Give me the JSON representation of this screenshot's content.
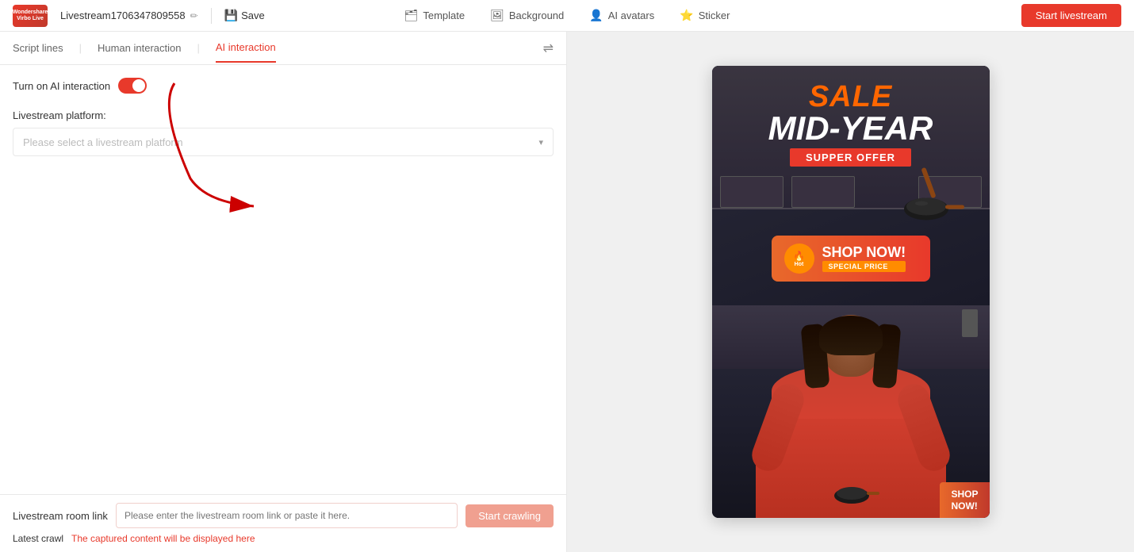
{
  "header": {
    "logo_line1": "Wondershare",
    "logo_line2": "Virbo Live",
    "project_title": "Livestream1706347809558",
    "save_label": "Save",
    "nav_items": [
      {
        "id": "template",
        "label": "Template",
        "icon": "🗂"
      },
      {
        "id": "background",
        "label": "Background",
        "icon": "🖼"
      },
      {
        "id": "ai_avatars",
        "label": "AI avatars",
        "icon": "👤"
      },
      {
        "id": "sticker",
        "label": "Sticker",
        "icon": "⭐"
      }
    ],
    "start_button_label": "Start livestream"
  },
  "left_panel": {
    "tabs": [
      {
        "id": "script_lines",
        "label": "Script lines",
        "active": false
      },
      {
        "id": "human_interaction",
        "label": "Human interaction",
        "active": false
      },
      {
        "id": "ai_interaction",
        "label": "AI interaction",
        "active": true
      }
    ],
    "ai_toggle_label": "Turn on AI interaction",
    "toggle_on": true,
    "platform_label": "Livestream platform:",
    "platform_placeholder": "Please select a livestream platform",
    "bottom": {
      "room_link_label": "Livestream room link",
      "room_link_placeholder": "Please enter the livestream room link or paste it here.",
      "start_crawl_label": "Start crawling",
      "latest_crawl_label": "Latest crawl",
      "crawl_placeholder": "The captured content will be displayed here"
    }
  },
  "preview": {
    "sale_word": "SALE",
    "mid_year": "MID-YEAR",
    "supper_offer": "SUPPER OFFER",
    "shop_now": "SHOP NOW!",
    "hot_label": "Hot",
    "special_price": "SPECIAL PRICE",
    "shop_now_bottom": "SHOP\nNOW!"
  },
  "icons": {
    "edit": "✏",
    "save": "🖫",
    "chevron_down": "⌄",
    "equalizer": "⇌"
  }
}
